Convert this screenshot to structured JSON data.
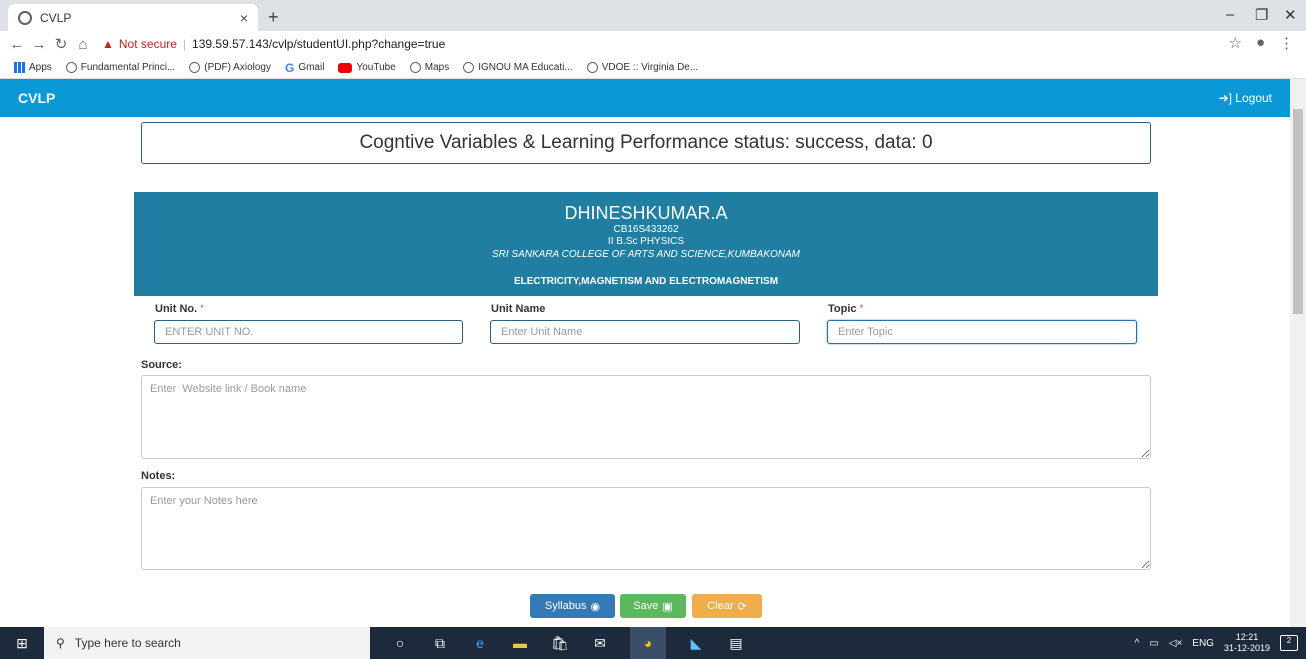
{
  "browser": {
    "tab_title": "CVLP",
    "tab_close": "×",
    "new_tab": "+",
    "not_secure": "Not secure",
    "url": "139.59.57.143/cvlp/studentUI.php?change=true",
    "bookmarks": [
      "Apps",
      "Fundamental Princi...",
      "(PDF) Axiology",
      "Gmail",
      "YouTube",
      "Maps",
      "IGNOU MA Educati...",
      "VDOE :: Virginia De..."
    ]
  },
  "app": {
    "brand": "CVLP",
    "logout": "Logout"
  },
  "status_message": "Cogntive Variables & Learning Performance status: success, data: 0",
  "student": {
    "name": "DHINESHKUMAR.A",
    "id": "CB16S433262",
    "course": "II B.Sc PHYSICS",
    "college": "SRI SANKARA COLLEGE OF ARTS AND SCIENCE,KUMBAKONAM",
    "subject": "ELECTRICITY,MAGNETISM AND ELECTROMAGNETISM"
  },
  "form": {
    "unit_no_label": "Unit No.",
    "unit_no_placeholder": "ENTER UNIT NO.",
    "unit_name_label": "Unit Name",
    "unit_name_placeholder": "Enter Unit Name",
    "topic_label": "Topic",
    "topic_placeholder": "Enter Topic",
    "required_mark": "*",
    "source_label": "Source:",
    "source_placeholder": "Enter  Website link / Book name",
    "notes_label": "Notes:",
    "notes_placeholder": "Enter your Notes here"
  },
  "buttons": {
    "syllabus": "Syllabus",
    "save": "Save",
    "clear": "Clear"
  },
  "taskbar": {
    "search_placeholder": "Type here to search",
    "lang": "ENG",
    "time": "12:21",
    "date": "31-12-2019",
    "notif_count": "2"
  },
  "colors": {
    "appbar": "#0a98d6",
    "student_panel": "#1f7ea1",
    "syllabus_btn": "#337ab7",
    "save_btn": "#5cb85c",
    "clear_btn": "#f0ad4e"
  }
}
